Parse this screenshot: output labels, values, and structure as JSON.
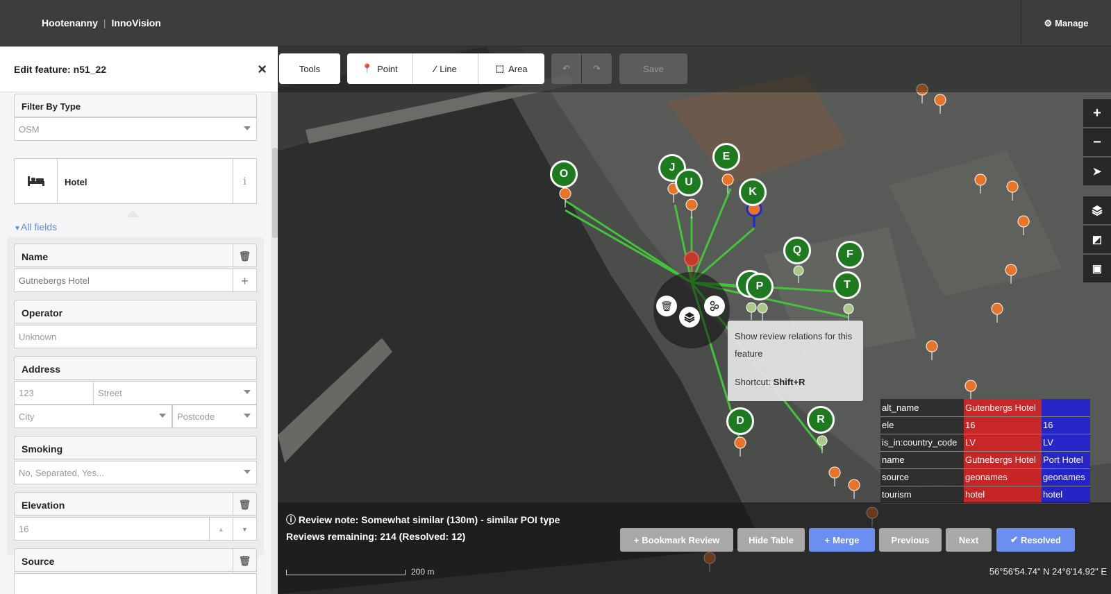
{
  "header": {
    "brand_left": "Hootenanny",
    "brand_sep": "|",
    "brand_right": "InnoVision",
    "manage_label": "Manage"
  },
  "sidebar": {
    "title": "Edit feature: n51_22",
    "filter_label": "Filter By Type",
    "filter_value": "OSM",
    "preset_name": "Hotel",
    "preset_info": "i",
    "all_fields_label": "All fields",
    "fields": {
      "name_label": "Name",
      "name_value": "Gutnebergs Hotel",
      "operator_label": "Operator",
      "operator_placeholder": "Unknown",
      "address_label": "Address",
      "housenumber_placeholder": "123",
      "street_placeholder": "Street",
      "city_placeholder": "City",
      "postcode_placeholder": "Postcode",
      "smoking_label": "Smoking",
      "smoking_placeholder": "No, Separated, Yes...",
      "elevation_label": "Elevation",
      "elevation_value": "16",
      "source_label": "Source"
    }
  },
  "toolbar": {
    "tools": "Tools",
    "point": "Point",
    "line": "Line",
    "area": "Area",
    "save": "Save"
  },
  "tooltip": {
    "text": "Show review relations for this feature",
    "shortcut_label": "Shortcut:",
    "shortcut_key": "Shift+R"
  },
  "markers": [
    "O",
    "J",
    "U",
    "E",
    "K",
    "Q",
    "F",
    "S",
    "P",
    "T",
    "D",
    "R"
  ],
  "attributes": [
    {
      "key": "alt_name",
      "a": "Gutenbergs Hotel",
      "b": ""
    },
    {
      "key": "ele",
      "a": "16",
      "b": "16"
    },
    {
      "key": "is_in:country_code",
      "a": "LV",
      "b": "LV"
    },
    {
      "key": "name",
      "a": "Gutnebergs Hotel",
      "b": "Port Hotel"
    },
    {
      "key": "source",
      "a": "geonames",
      "b": "geonames"
    },
    {
      "key": "tourism",
      "a": "hotel",
      "b": "hotel"
    }
  ],
  "review": {
    "note": "Review note: Somewhat similar (130m) - similar POI type",
    "remaining": "Reviews remaining: 214 (Resolved: 12)"
  },
  "buttons": {
    "bookmark": "Bookmark Review",
    "hide_table": "Hide Table",
    "merge": "Merge",
    "previous": "Previous",
    "next": "Next",
    "resolved": "Resolved"
  },
  "scale_label": "200 m",
  "coordinates": "56°56'54.74\" N 24°6'14.92\" E",
  "colors": {
    "accent": "#6b8ff0",
    "link_green": "#43c43a",
    "marker_green": "#1e7a1e",
    "poi_orange": "#e8742a",
    "table_red": "#dc1e1e",
    "table_blue": "#1e1edc"
  }
}
